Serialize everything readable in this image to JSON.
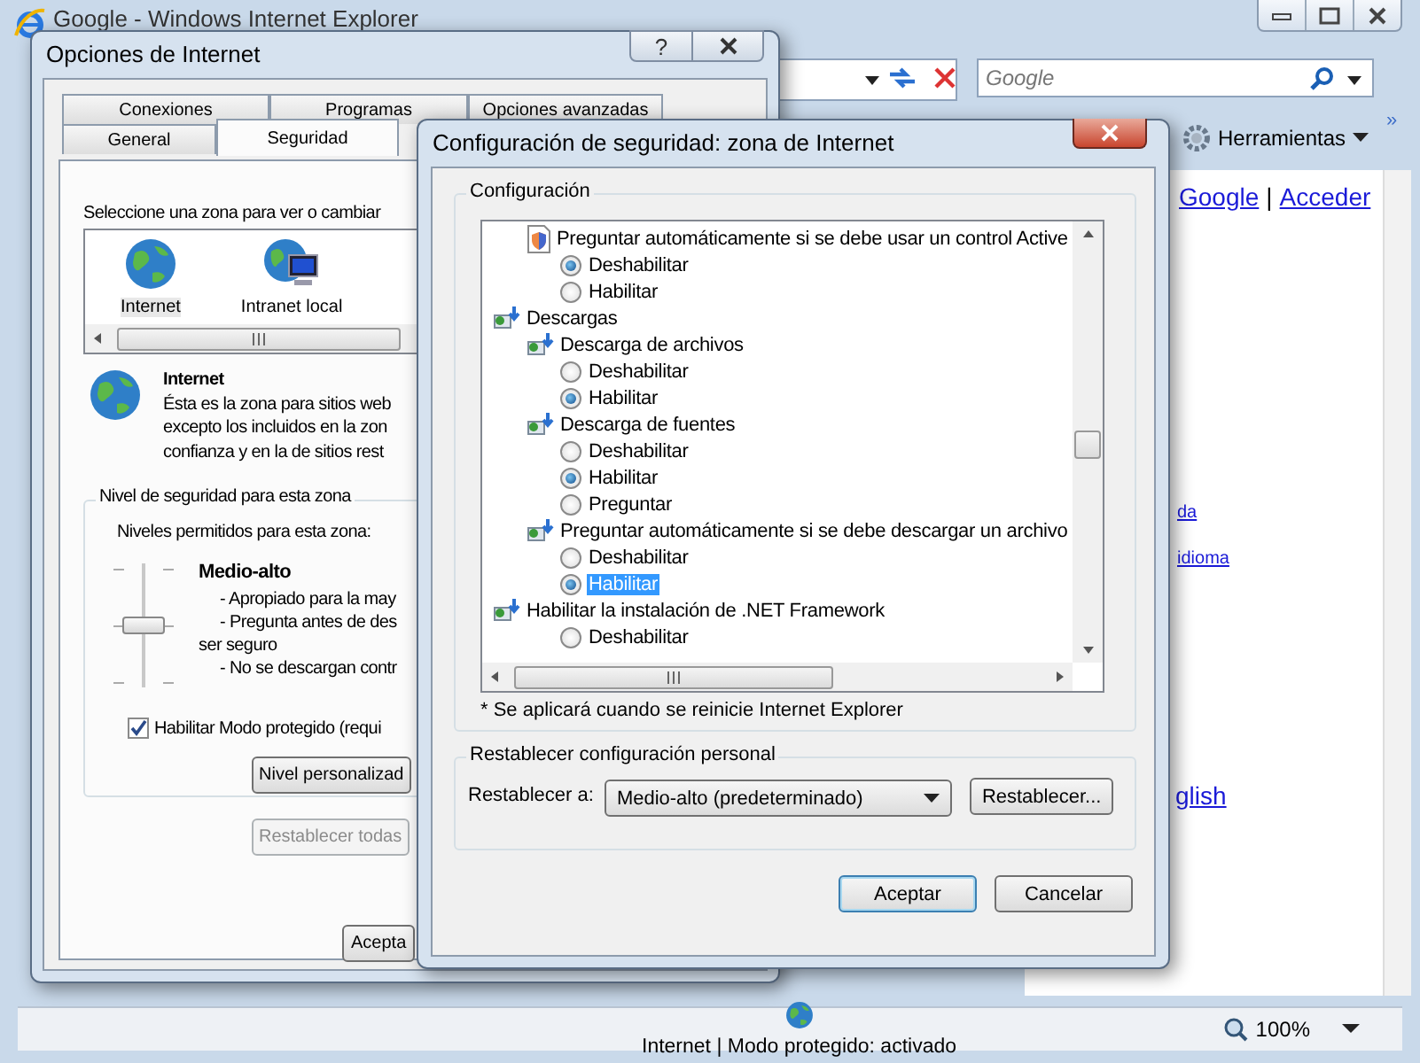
{
  "browser": {
    "title": "Google - Windows Internet Explorer",
    "search": {
      "placeholder": "Google"
    },
    "tools_menu": "Herramientas",
    "more": "»",
    "header_links": [
      {
        "kind": "link",
        "label": "Google"
      },
      {
        "kind": "separator",
        "label": "|"
      },
      {
        "kind": "link",
        "label": "Acceder"
      }
    ],
    "page_links": [
      "da",
      "idioma",
      "glish"
    ],
    "status_bar": {
      "zone": "Internet | Modo protegido: activado",
      "zoom": "100%"
    }
  },
  "internet_options": {
    "title": "Opciones de Internet",
    "help": "?",
    "tabs_back": [
      {
        "label": "Conexiones",
        "selected": false
      },
      {
        "label": "Programas",
        "selected": false
      },
      {
        "label": "Opciones avanzadas",
        "selected": false
      }
    ],
    "tabs_front": [
      {
        "label": "General",
        "selected": false
      },
      {
        "label": "Seguridad",
        "selected": true
      }
    ],
    "zone_prompt": "Seleccione una zona para ver o cambiar",
    "zones": [
      {
        "kind": "internet",
        "label": "Internet",
        "selected": true
      },
      {
        "kind": "intranet",
        "label": "Intranet local",
        "selected": false
      }
    ],
    "zone_name": "Internet",
    "zone_description": [
      "Ésta es la zona para sitios web",
      "excepto los incluidos en la zon",
      "confianza y en la de sitios rest"
    ],
    "security_level": {
      "legend": "Nivel de seguridad para esta zona",
      "allowed": "Niveles permitidos para esta zona:",
      "level": 0.5,
      "name": "Medio-alto",
      "bullets": [
        {
          "lines": [
            "- Apropiado para la may"
          ]
        },
        {
          "lines": [
            "- Pregunta antes de des",
            "ser seguro"
          ]
        },
        {
          "lines": [
            "- No se descargan contr"
          ]
        }
      ]
    },
    "protected_mode": {
      "label": "Habilitar Modo protegido (requi",
      "checked": true
    },
    "custom_button": {
      "label": "Nivel personalizad",
      "disabled": false
    },
    "reset_all_button": {
      "label": "Restablecer todas",
      "disabled": true
    },
    "ok_button": "Acepta"
  },
  "security_settings": {
    "title": "Configuración de seguridad: zona de Internet",
    "group": "Configuración",
    "tree": [
      {
        "kind": "activex",
        "label": "Preguntar automáticamente si se debe usar un control Active",
        "options": [
          {
            "label": "Deshabilitar",
            "selected": true,
            "focused": false
          },
          {
            "label": "Habilitar",
            "selected": false,
            "focused": false
          }
        ]
      },
      {
        "kind": "download",
        "label": "Descargas",
        "children": [
          {
            "kind": "download",
            "label": "Descarga de archivos",
            "options": [
              {
                "label": "Deshabilitar",
                "selected": false,
                "focused": false
              },
              {
                "label": "Habilitar",
                "selected": true,
                "focused": false
              }
            ]
          },
          {
            "kind": "download",
            "label": "Descarga de fuentes",
            "options": [
              {
                "label": "Deshabilitar",
                "selected": false,
                "focused": false
              },
              {
                "label": "Habilitar",
                "selected": true,
                "focused": false
              },
              {
                "label": "Preguntar",
                "selected": false,
                "focused": false
              }
            ]
          },
          {
            "kind": "download",
            "label": "Preguntar automáticamente si se debe descargar un archivo",
            "options": [
              {
                "label": "Deshabilitar",
                "selected": false,
                "focused": false
              },
              {
                "label": "Habilitar",
                "selected": true,
                "focused": true
              }
            ]
          }
        ]
      },
      {
        "kind": "download",
        "label": "Habilitar la instalación de .NET Framework",
        "options": [
          {
            "label": "Deshabilitar",
            "selected": false,
            "focused": false
          }
        ]
      }
    ],
    "note": "* Se aplicará cuando se reinicie Internet Explorer",
    "reset": {
      "legend": "Restablecer configuración personal",
      "label": "Restablecer a:",
      "value": "Medio-alto (predeterminado)",
      "button": "Restablecer..."
    },
    "buttons": [
      {
        "label": "Aceptar",
        "default": true
      },
      {
        "label": "Cancelar",
        "default": false
      }
    ]
  }
}
